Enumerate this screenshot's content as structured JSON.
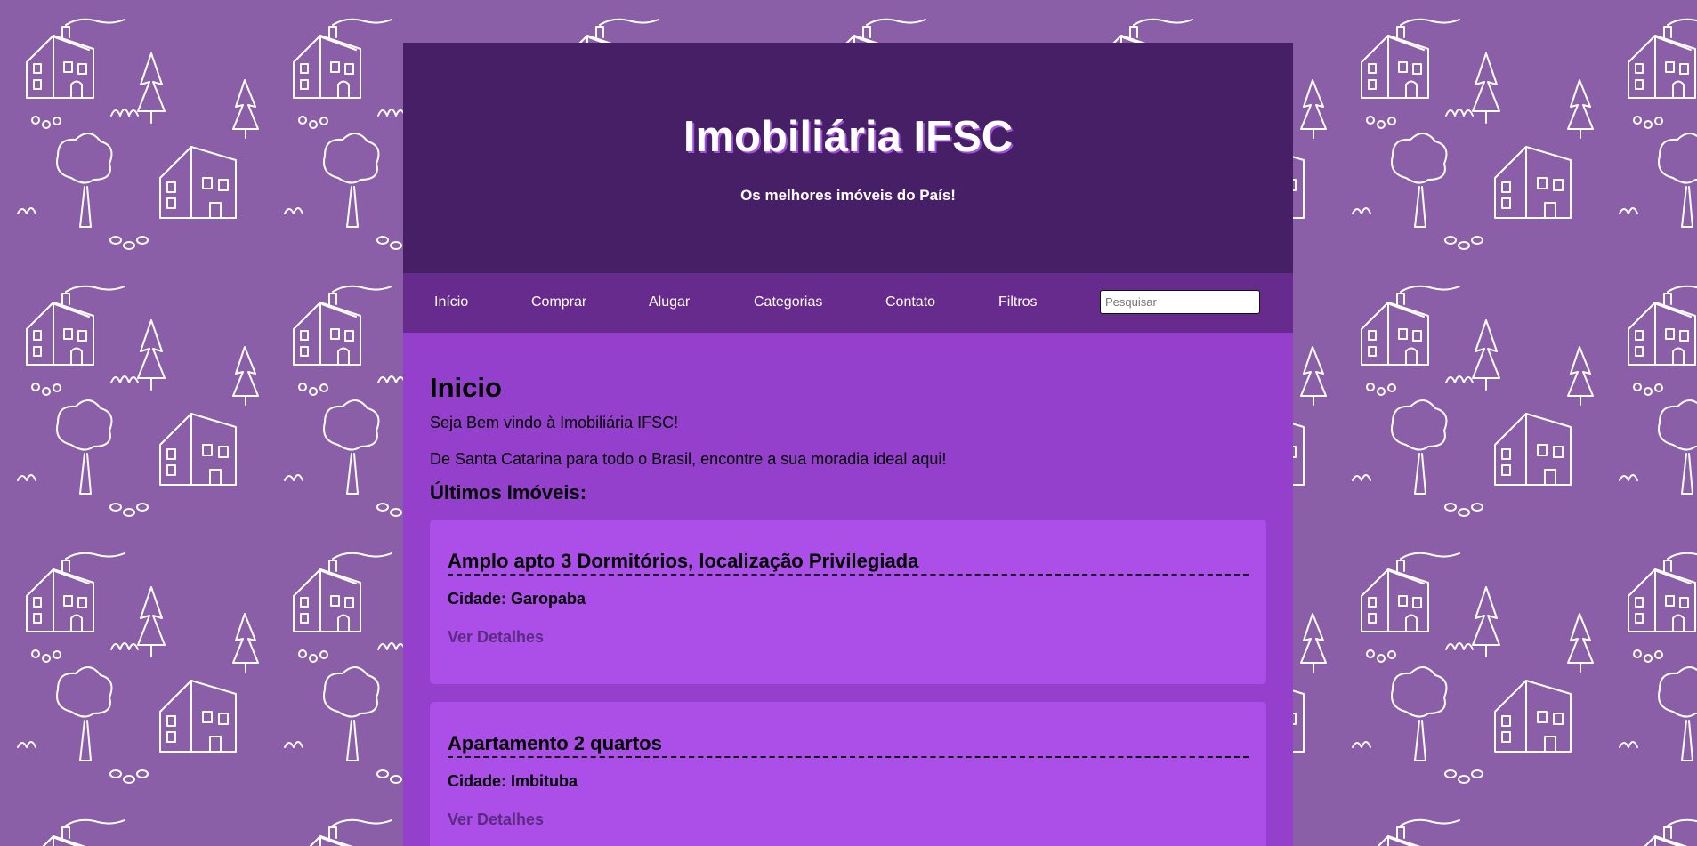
{
  "header": {
    "title": "Imobiliária IFSC",
    "tagline": "Os melhores imóveis do País!"
  },
  "nav": {
    "items": [
      "Início",
      "Comprar",
      "Alugar",
      "Categorias",
      "Contato",
      "Filtros"
    ],
    "search_placeholder": "Pesquisar"
  },
  "main": {
    "title": "Inicio",
    "welcome": "Seja Bem vindo à Imobiliária IFSC!",
    "subtitle": "De Santa Catarina para todo o Brasil, encontre a sua moradia ideal aqui!",
    "latest_heading": "Últimos Imóveis:",
    "listings": [
      {
        "title": "Amplo apto 3 Dormitórios, localização Privilegiada",
        "city": "Cidade: Garopaba",
        "link": "Ver Detalhes"
      },
      {
        "title": "Apartamento 2 quartos",
        "city": "Cidade: Imbituba",
        "link": "Ver Detalhes"
      }
    ]
  },
  "colors": {
    "background": "#8b5fa8",
    "header": "#471f66",
    "nav": "#662b8c",
    "main": "#9440cc",
    "card": "#ac4fe8",
    "link": "#5a2a85"
  },
  "icons": {
    "background_pattern": "house-and-tree-doodle-pattern"
  }
}
